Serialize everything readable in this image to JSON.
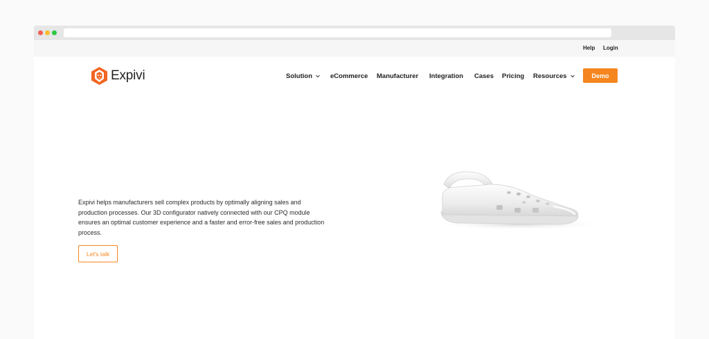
{
  "topbar": {
    "help_label": "Help",
    "login_label": "Login"
  },
  "brand": {
    "name": "Expivi",
    "logo_icon": "lion-head-icon",
    "color": "#f5861f"
  },
  "nav": {
    "items": [
      {
        "label": "Solution",
        "dropdown": true
      },
      {
        "label": "eCommerce",
        "dropdown": false
      },
      {
        "label": "Manufacturer",
        "dropdown": false
      },
      {
        "label": "Integration",
        "dropdown": false
      },
      {
        "label": "Cases",
        "dropdown": false
      },
      {
        "label": "Pricing",
        "dropdown": false
      },
      {
        "label": "Resources",
        "dropdown": true
      }
    ],
    "demo_label": "Demo"
  },
  "hero": {
    "description": "Expivi helps manufacturers sell complex products by optimally aligning sales and production processes. Our 3D configurator natively connected with our CPQ module ensures an optimal customer experience and a faster and error-free sales and production process.",
    "cta_label": "Let's talk",
    "image": "white-clog-shoe"
  }
}
